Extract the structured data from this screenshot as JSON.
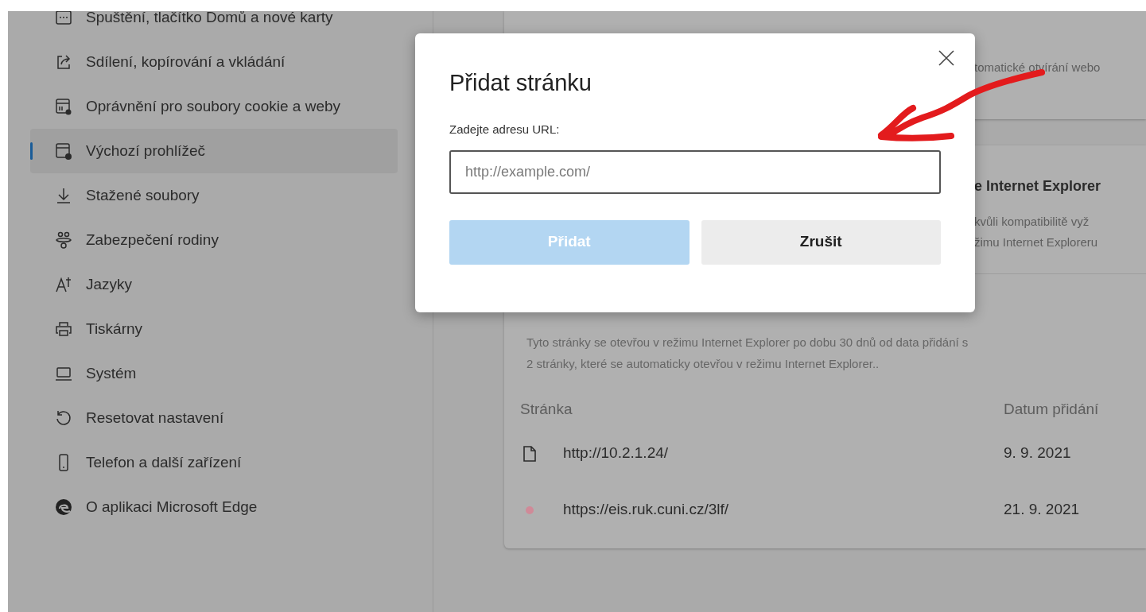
{
  "sidebar": {
    "items": [
      {
        "label": "Spuštění, tlačítko Domů a nové karty",
        "selected": false
      },
      {
        "label": "Sdílení, kopírování a vkládání",
        "selected": false
      },
      {
        "label": "Oprávnění pro soubory cookie a weby",
        "selected": false
      },
      {
        "label": "Výchozí prohlížeč",
        "selected": true
      },
      {
        "label": "Stažené soubory",
        "selected": false
      },
      {
        "label": "Zabezpečení rodiny",
        "selected": false
      },
      {
        "label": "Jazyky",
        "selected": false
      },
      {
        "label": "Tiskárny",
        "selected": false
      },
      {
        "label": "Systém",
        "selected": false
      },
      {
        "label": "Resetovat nastavení",
        "selected": false
      },
      {
        "label": "Telefon a další zařízení",
        "selected": false
      },
      {
        "label": "O aplikaci Microsoft Edge",
        "selected": false
      }
    ]
  },
  "top_card": {
    "text": "tomatické otvírání webo"
  },
  "ie_card": {
    "heading": "e Internet Explorer",
    "lines": [
      "kvůli kompatibilitě vyž",
      "žimu Internet Exploreru"
    ],
    "description": [
      "Tyto stránky se otevřou v režimu Internet Explorer po dobu 30 dnů od data přidání s",
      "2 stránky, které se automaticky otevřou v režimu Internet Explorer.."
    ],
    "table": {
      "columns": [
        "Stránka",
        "Datum přidání"
      ],
      "rows": [
        {
          "kind": "page",
          "page": "http://10.2.1.24/",
          "date": "9. 9. 2021"
        },
        {
          "kind": "favicon",
          "color": "#d08a98",
          "page": "https://eis.ruk.cuni.cz/3lf/",
          "date": "21. 9. 2021"
        }
      ]
    }
  },
  "dialog": {
    "title": "Přidat stránku",
    "field_label": "Zadejte adresu URL:",
    "placeholder": "http://example.com/",
    "buttons": [
      {
        "label": "Přidat",
        "disabled": true
      },
      {
        "label": "Zrušit",
        "disabled": false
      }
    ]
  }
}
